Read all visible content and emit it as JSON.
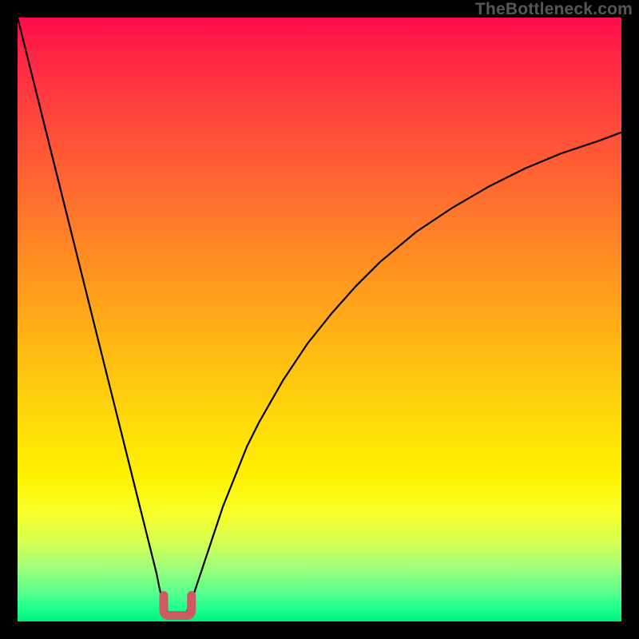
{
  "watermark": "TheBottleneck.com",
  "colors": {
    "background": "#000000",
    "gradient_top": "#ff0a4a",
    "gradient_bottom": "#00f07a",
    "curve": "#000000",
    "dip_marker": "#cc5a63"
  },
  "chart_data": {
    "type": "line",
    "title": "",
    "xlabel": "",
    "ylabel": "",
    "xlim": [
      0,
      100
    ],
    "ylim": [
      0,
      100
    ],
    "series": [
      {
        "name": "left-branch",
        "x": [
          0,
          2,
          4,
          6,
          8,
          10,
          12,
          14,
          16,
          18,
          20,
          21,
          22,
          23,
          23.5,
          24,
          24.5,
          25
        ],
        "y": [
          100,
          92,
          84,
          76,
          68,
          60,
          52,
          44,
          36,
          28,
          20,
          16,
          12,
          8,
          5.5,
          3.5,
          2,
          1.5
        ]
      },
      {
        "name": "dip-bottom",
        "x": [
          25,
          25.5,
          26,
          26.5,
          27,
          27.5,
          28
        ],
        "y": [
          1.5,
          1.0,
          0.8,
          0.8,
          1.0,
          1.2,
          1.5
        ]
      },
      {
        "name": "right-branch",
        "x": [
          28,
          29,
          30,
          32,
          34,
          36,
          38,
          40,
          44,
          48,
          52,
          56,
          60,
          66,
          72,
          78,
          84,
          90,
          96,
          100
        ],
        "y": [
          1.5,
          4,
          7,
          13,
          19,
          24,
          29,
          33,
          40,
          46,
          51,
          55.5,
          59.5,
          64.5,
          68.5,
          72,
          75,
          77.5,
          79.5,
          81
        ]
      }
    ],
    "marker": {
      "name": "dip-marker-U",
      "shape": "U",
      "center_x": 26.5,
      "bottom_y": 1.0,
      "width": 4.5,
      "height": 3.3,
      "color": "#cc5a63",
      "stroke_width_px": 11
    }
  }
}
